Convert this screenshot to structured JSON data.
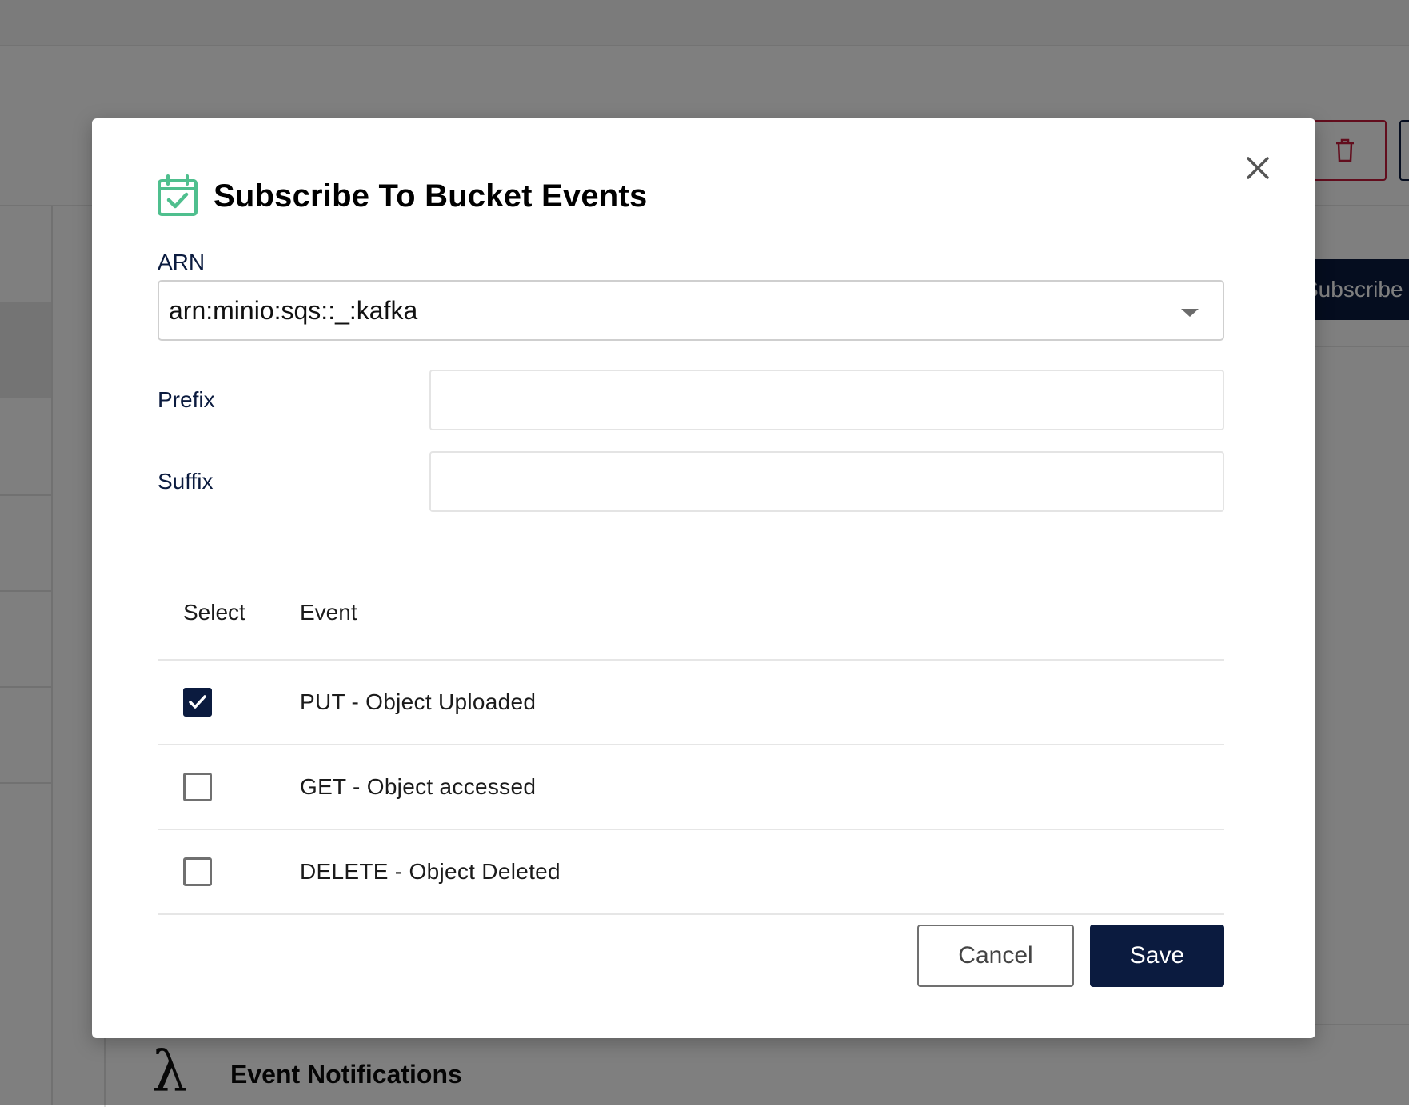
{
  "background": {
    "subscribe_button_label": "Subscribe to Event",
    "section_title": "Event Notifications",
    "section_icon": "lambda-icon"
  },
  "modal": {
    "title": "Subscribe To Bucket Events",
    "title_icon": "calendar-check-icon",
    "close_icon": "close-icon",
    "arn": {
      "label": "ARN",
      "value": "arn:minio:sqs::_:kafka"
    },
    "prefix": {
      "label": "Prefix",
      "value": ""
    },
    "suffix": {
      "label": "Suffix",
      "value": ""
    },
    "table": {
      "headers": [
        "Select",
        "Event"
      ],
      "rows": [
        {
          "event": "PUT - Object Uploaded",
          "checked": true
        },
        {
          "event": "GET - Object accessed",
          "checked": false
        },
        {
          "event": "DELETE - Object Deleted",
          "checked": false
        }
      ]
    },
    "buttons": {
      "cancel": "Cancel",
      "save": "Save"
    }
  },
  "colors": {
    "primary": "#0b1b3f",
    "accent_green": "#4fbf8e",
    "danger": "#c51b3b"
  }
}
